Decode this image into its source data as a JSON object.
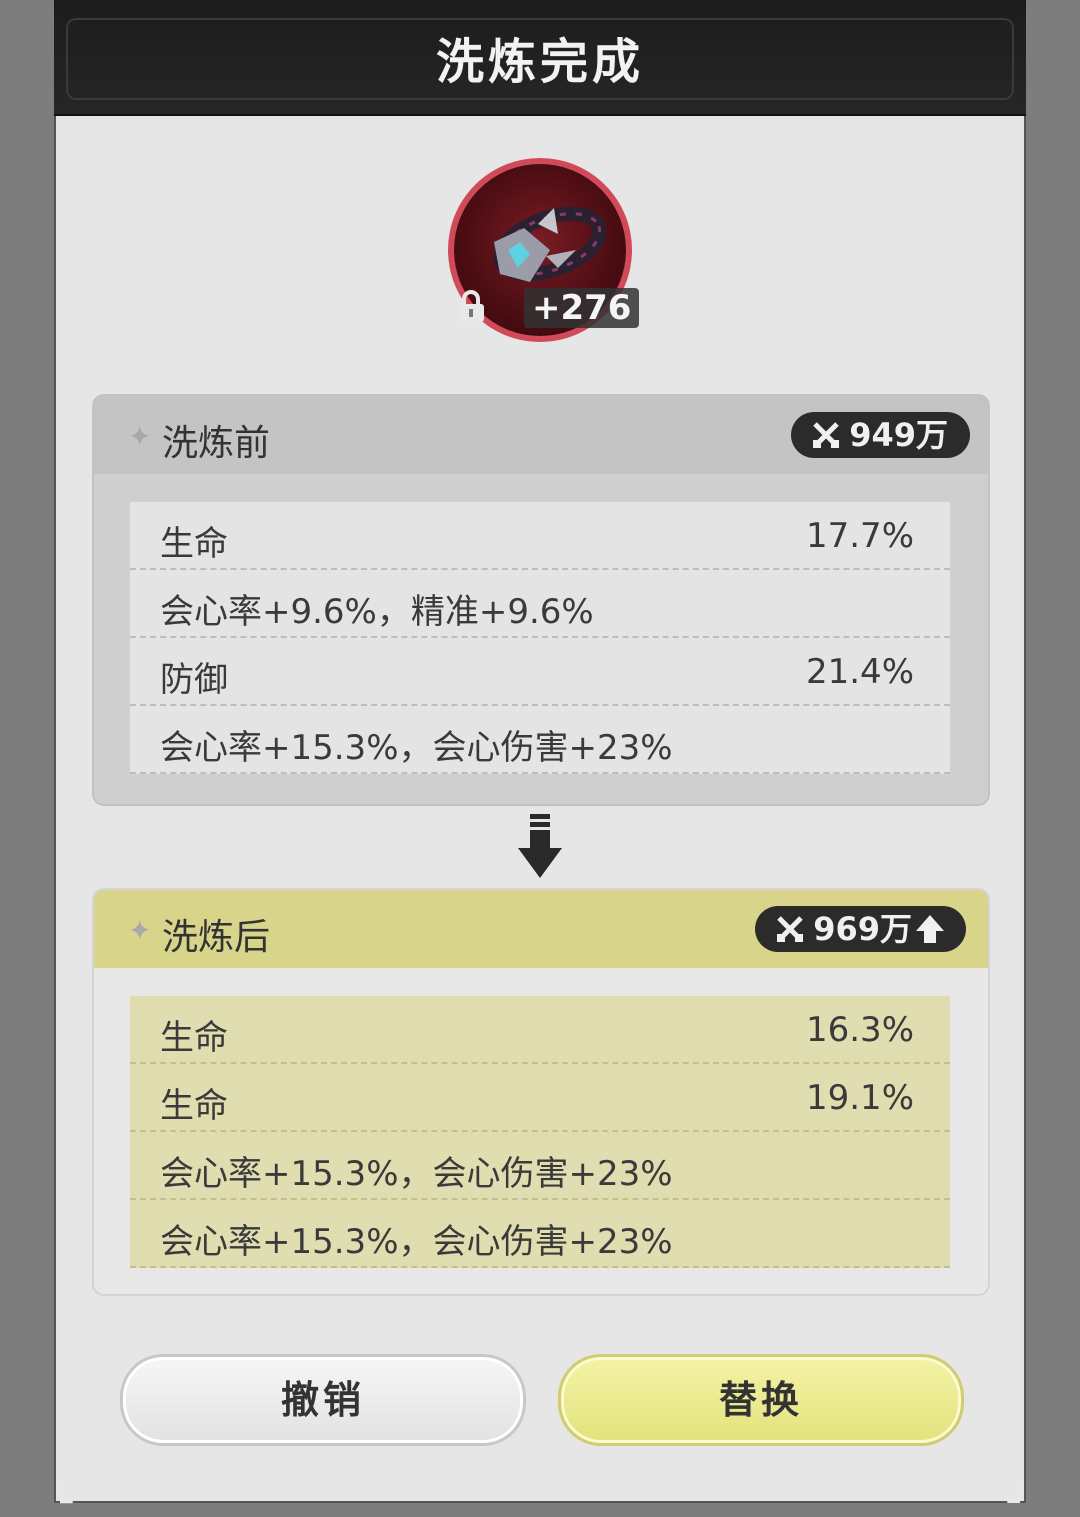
{
  "dialog": {
    "title": "洗炼完成"
  },
  "item": {
    "level": "+276",
    "icon": "necklace-icon",
    "lock_icon": "lock-icon"
  },
  "before": {
    "title": "洗炼前",
    "power": "949万",
    "rows": [
      {
        "label": "生命",
        "value": "17.7%"
      },
      {
        "label": "会心率+9.6%，精准+9.6%",
        "value": ""
      },
      {
        "label": "防御",
        "value": "21.4%"
      },
      {
        "label": "会心率+15.3%，会心伤害+23%",
        "value": ""
      }
    ]
  },
  "after": {
    "title": "洗炼后",
    "power": "969万",
    "rows": [
      {
        "label": "生命",
        "value": "16.3%"
      },
      {
        "label": "生命",
        "value": "19.1%"
      },
      {
        "label": "会心率+15.3%，会心伤害+23%",
        "value": ""
      },
      {
        "label": "会心率+15.3%，会心伤害+23%",
        "value": ""
      }
    ]
  },
  "buttons": {
    "cancel": "撤销",
    "replace": "替换"
  },
  "colors": {
    "after_header": "#d8d58a",
    "replace_button": "#e9e88a",
    "item_ring": "#d14a5a"
  }
}
